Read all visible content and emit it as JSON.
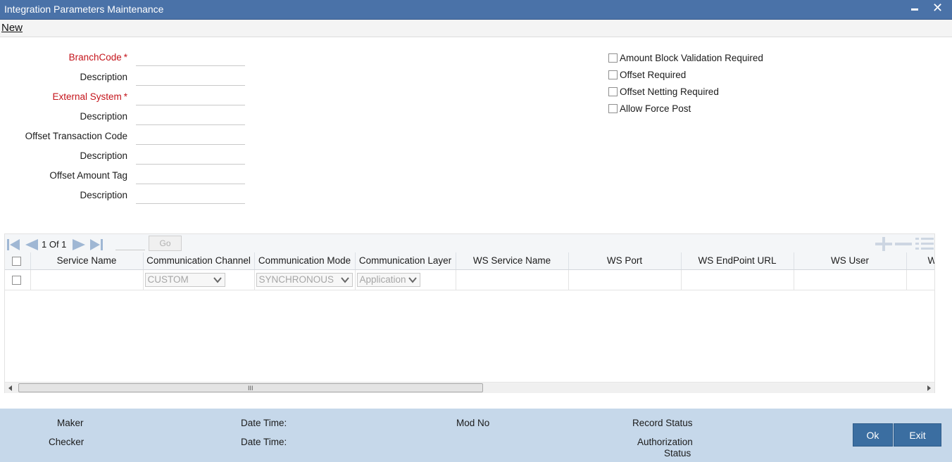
{
  "window": {
    "title": "Integration Parameters Maintenance",
    "close_glyph": "✕"
  },
  "menu": {
    "new_label": "New"
  },
  "form": {
    "branch_code_label": "BranchCode",
    "branch_desc_label": "Description",
    "external_system_label": "External System",
    "external_desc_label": "Description",
    "offset_txn_code_label": "Offset Transaction Code",
    "offset_txn_desc_label": "Description",
    "offset_amount_tag_label": "Offset Amount Tag",
    "offset_amount_desc_label": "Description",
    "required_marker": "*"
  },
  "options": {
    "amount_block": "Amount Block Validation Required",
    "offset_required": "Offset Required",
    "offset_netting": "Offset Netting Required",
    "allow_force_post": "Allow Force Post"
  },
  "grid": {
    "pager_text": "1 Of 1",
    "go_label": "Go",
    "columns": [
      "Service Name",
      "Communication Channel",
      "Communication Mode",
      "Communication Layer",
      "WS Service Name",
      "WS Port",
      "WS EndPoint URL",
      "WS User",
      "W"
    ],
    "row": {
      "channel": "CUSTOM",
      "mode": "SYNCHRONOUS",
      "layer": "Application"
    },
    "scroll_grip": "III"
  },
  "footer": {
    "maker": "Maker",
    "checker": "Checker",
    "date_time_1": "Date Time:",
    "date_time_2": "Date Time:",
    "mod_no": "Mod No",
    "record_status": "Record Status",
    "authorization_status": "Authorization",
    "authorization_status_2": "Status",
    "ok_label": "Ok",
    "exit_label": "Exit"
  },
  "colors": {
    "titlebar": "#4a72a8",
    "required": "#c4141b",
    "footer": "#c6d8ea",
    "button": "#3b6ea1",
    "pager_icon": "#9fb7d4"
  }
}
